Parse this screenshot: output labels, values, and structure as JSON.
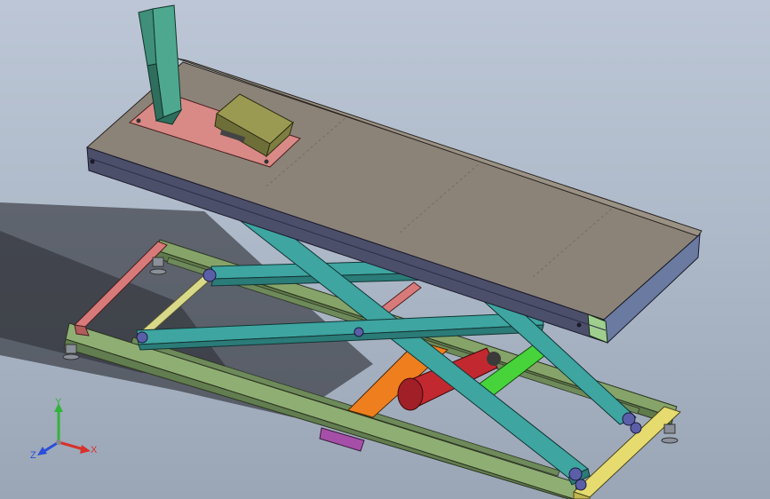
{
  "viewport": {
    "background_top": "#bcc6d6",
    "background_bottom": "#9aa6b6"
  },
  "model": {
    "parts": [
      "lift-platform",
      "front-wheel-clamp",
      "wheel-chock",
      "scissor-arms",
      "base-frame",
      "hydraulic-cylinder",
      "leveling-feet",
      "guide-rails"
    ],
    "colors": {
      "platform_top": "#8c8378",
      "platform_side": "#4c4f6a",
      "clamp": "#3f8f7a",
      "clamp_plate": "#d98a86",
      "chock": "#8a8a48",
      "scissor": "#3ea5a1",
      "base_frame": "#7c9a63",
      "end_beam_left": "#d97a7a",
      "end_beam_right": "#e6db6e",
      "pivot_rod": "#d9d98a",
      "cylinder": "#c2282f",
      "cylinder_mount": "#ef7f1e",
      "link_bar": "#46d43a"
    }
  },
  "triad": {
    "x_label": "X",
    "y_label": "Y",
    "z_label": "Z",
    "x_color": "#d8312b",
    "y_color": "#31b43a",
    "z_color": "#2b4ed8"
  }
}
